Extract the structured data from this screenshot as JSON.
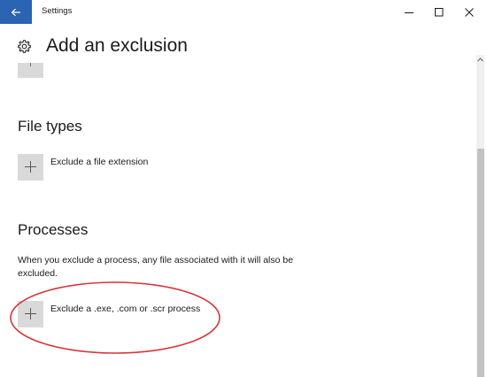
{
  "window": {
    "title": "Settings"
  },
  "header": {
    "title": "Add an exclusion"
  },
  "file_types": {
    "heading": "File types",
    "action_label": "Exclude a file extension"
  },
  "processes": {
    "heading": "Processes",
    "description": "When you exclude a process, any file associated with it will also be excluded.",
    "action_label": "Exclude a .exe, .com or .scr process"
  },
  "colors": {
    "accent": "#2b64b3",
    "tile": "#d9d9d9",
    "annotation": "#d9343a"
  },
  "icons": {
    "back": "back-arrow-icon",
    "minimize": "minimize-icon",
    "maximize": "maximize-icon",
    "close": "close-icon",
    "settings": "gear-icon",
    "add": "plus-icon"
  }
}
